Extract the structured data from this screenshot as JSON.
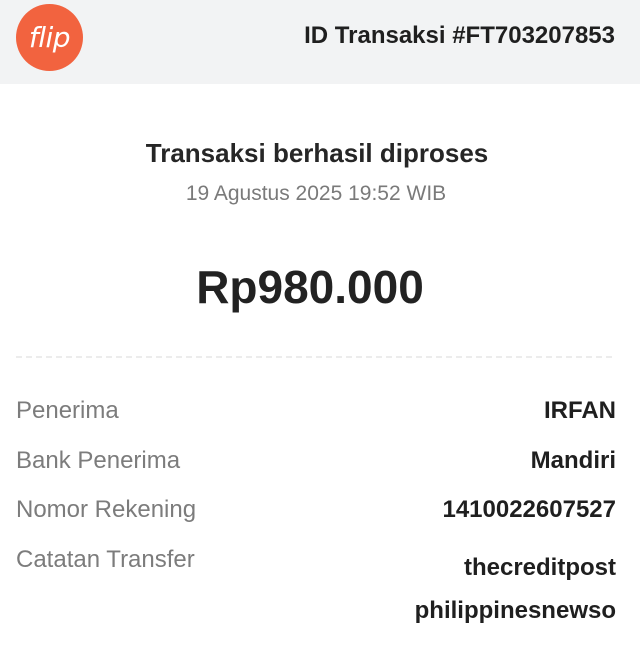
{
  "header": {
    "logo_text": "flip",
    "logo_color": "#f2633f",
    "transaction_id": "ID Transaksi #FT703207853"
  },
  "receipt": {
    "status": "Transaksi berhasil diproses",
    "timestamp": "19 Agustus 2025 19:52 WIB",
    "amount": "Rp980.000"
  },
  "details": {
    "recipient_label": "Penerima",
    "recipient_value": "IRFAN",
    "bank_label": "Bank Penerima",
    "bank_value": "Mandiri",
    "account_label": "Nomor Rekening",
    "account_value": "1410022607527",
    "note_label": "Catatan Transfer",
    "note_line1": "thecreditpost",
    "note_line2": "philippinesnewso"
  }
}
